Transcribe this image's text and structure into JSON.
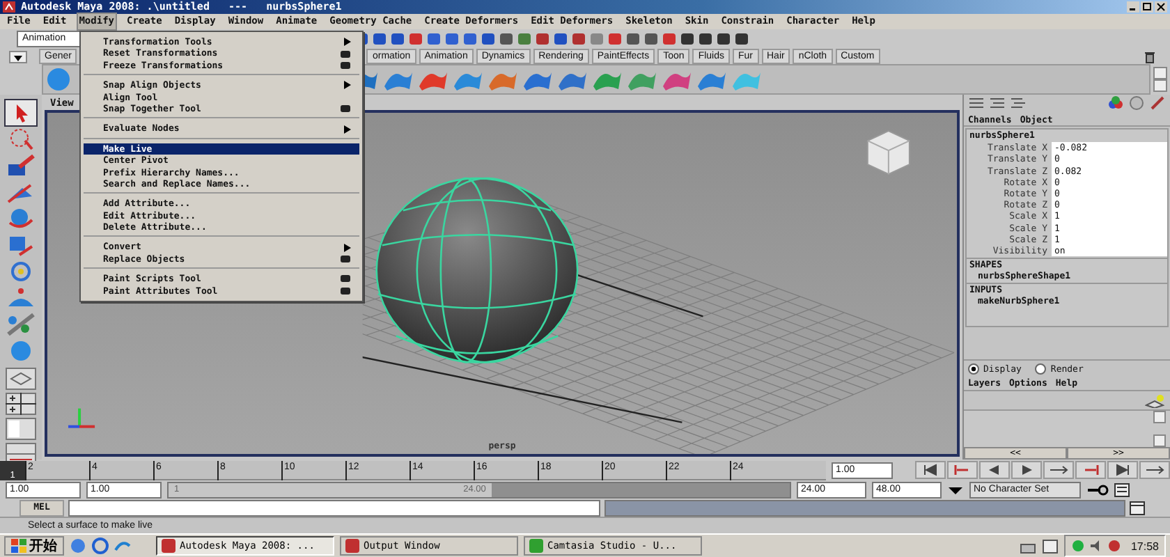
{
  "window": {
    "title": "Autodesk Maya 2008: .\\untitled   ---   nurbsSphere1"
  },
  "menu_bar": [
    {
      "label": "File",
      "selected": false
    },
    {
      "label": "Edit",
      "selected": false
    },
    {
      "label": "Modify",
      "selected": true
    },
    {
      "label": "Create",
      "selected": false
    },
    {
      "label": "Display",
      "selected": false
    },
    {
      "label": "Window",
      "selected": false
    },
    {
      "label": "Animate",
      "selected": false
    },
    {
      "label": "Geometry Cache",
      "selected": false
    },
    {
      "label": "Create Deformers",
      "selected": false
    },
    {
      "label": "Edit Deformers",
      "selected": false
    },
    {
      "label": "Skeleton",
      "selected": false
    },
    {
      "label": "Skin",
      "selected": false
    },
    {
      "label": "Constrain",
      "selected": false
    },
    {
      "label": "Character",
      "selected": false
    },
    {
      "label": "Help",
      "selected": false
    }
  ],
  "status_line": {
    "mode": "Animation"
  },
  "shelf_tabs": [
    "Gener",
    "ormation",
    "Animation",
    "Dynamics",
    "Rendering",
    "PaintEffects",
    "Toon",
    "Fluids",
    "Fur",
    "Hair",
    "nCloth",
    "Custom"
  ],
  "modify_menu": [
    {
      "kind": "item",
      "label": "Transformation Tools",
      "submenu": true,
      "option_box": false,
      "selected": false
    },
    {
      "kind": "item",
      "label": "Reset Transformations",
      "submenu": false,
      "option_box": true,
      "selected": false
    },
    {
      "kind": "item",
      "label": "Freeze Transformations",
      "submenu": false,
      "option_box": true,
      "selected": false
    },
    {
      "kind": "separator"
    },
    {
      "kind": "item",
      "label": "Snap Align Objects",
      "submenu": true,
      "option_box": false,
      "selected": false
    },
    {
      "kind": "item",
      "label": "Align Tool",
      "submenu": false,
      "option_box": false,
      "selected": false
    },
    {
      "kind": "item",
      "label": "Snap Together Tool",
      "submenu": false,
      "option_box": true,
      "selected": false
    },
    {
      "kind": "separator"
    },
    {
      "kind": "item",
      "label": "Evaluate Nodes",
      "submenu": true,
      "option_box": false,
      "selected": false
    },
    {
      "kind": "separator"
    },
    {
      "kind": "item",
      "label": "Make Live",
      "submenu": false,
      "option_box": false,
      "selected": true
    },
    {
      "kind": "item",
      "label": "Center Pivot",
      "submenu": false,
      "option_box": false,
      "selected": false
    },
    {
      "kind": "item",
      "label": "Prefix Hierarchy Names...",
      "submenu": false,
      "option_box": false,
      "selected": false
    },
    {
      "kind": "item",
      "label": "Search and Replace Names...",
      "submenu": false,
      "option_box": false,
      "selected": false
    },
    {
      "kind": "separator"
    },
    {
      "kind": "item",
      "label": "Add Attribute...",
      "submenu": false,
      "option_box": false,
      "selected": false
    },
    {
      "kind": "item",
      "label": "Edit Attribute...",
      "submenu": false,
      "option_box": false,
      "selected": false
    },
    {
      "kind": "item",
      "label": "Delete Attribute...",
      "submenu": false,
      "option_box": false,
      "selected": false
    },
    {
      "kind": "separator"
    },
    {
      "kind": "item",
      "label": "Convert",
      "submenu": true,
      "option_box": false,
      "selected": false
    },
    {
      "kind": "item",
      "label": "Replace Objects",
      "submenu": false,
      "option_box": true,
      "selected": false
    },
    {
      "kind": "separator"
    },
    {
      "kind": "item",
      "label": "Paint Scripts Tool",
      "submenu": false,
      "option_box": true,
      "selected": false
    },
    {
      "kind": "item",
      "label": "Paint Attributes Tool",
      "submenu": false,
      "option_box": true,
      "selected": false
    }
  ],
  "viewport": {
    "panel_menu": "View",
    "camera": "persp"
  },
  "channel_box": {
    "menu": [
      "Channels",
      "Object"
    ],
    "node": "nurbsSphere1",
    "attributes": [
      {
        "name": "Translate X",
        "value": "-0.082"
      },
      {
        "name": "Translate Y",
        "value": "0"
      },
      {
        "name": "Translate Z",
        "value": "0.082"
      },
      {
        "name": "Rotate X",
        "value": "0"
      },
      {
        "name": "Rotate Y",
        "value": "0"
      },
      {
        "name": "Rotate Z",
        "value": "0"
      },
      {
        "name": "Scale X",
        "value": "1"
      },
      {
        "name": "Scale Y",
        "value": "1"
      },
      {
        "name": "Scale Z",
        "value": "1"
      },
      {
        "name": "Visibility",
        "value": "on"
      }
    ],
    "shapes_header": "SHAPES",
    "shape": "nurbsSphereShape1",
    "inputs_header": "INPUTS",
    "input": "makeNurbSphere1"
  },
  "layer_editor": {
    "modes": [
      {
        "label": "Display",
        "selected": true
      },
      {
        "label": "Render",
        "selected": false
      }
    ],
    "menu": [
      "Layers",
      "Options",
      "Help"
    ],
    "page_buttons": [
      "<<",
      ">>"
    ]
  },
  "time_slider": {
    "current_frame": "1",
    "level": 0,
    "ticks": [
      "2",
      "4",
      "6",
      "8",
      "10",
      "12",
      "14",
      "16",
      "18",
      "20",
      "22",
      "24"
    ],
    "current_time": "1.00"
  },
  "range_slider": {
    "level": 0.52,
    "start": "1.00",
    "playback_start": "1.00",
    "range_start_label": "1",
    "range_end_label": "24.00",
    "playback_end": "24.00",
    "end": "48.00",
    "character_set": "No Character Set"
  },
  "command_line": {
    "label": "MEL"
  },
  "help_line": "Select a surface to make live",
  "taskbar": {
    "start": "开始",
    "tasks": [
      {
        "label": "Autodesk Maya 2008: ...",
        "selected": true
      },
      {
        "label": "Output Window",
        "selected": false
      },
      {
        "label": "Camtasia Studio - U...",
        "selected": false
      }
    ],
    "clock": "17:58"
  }
}
